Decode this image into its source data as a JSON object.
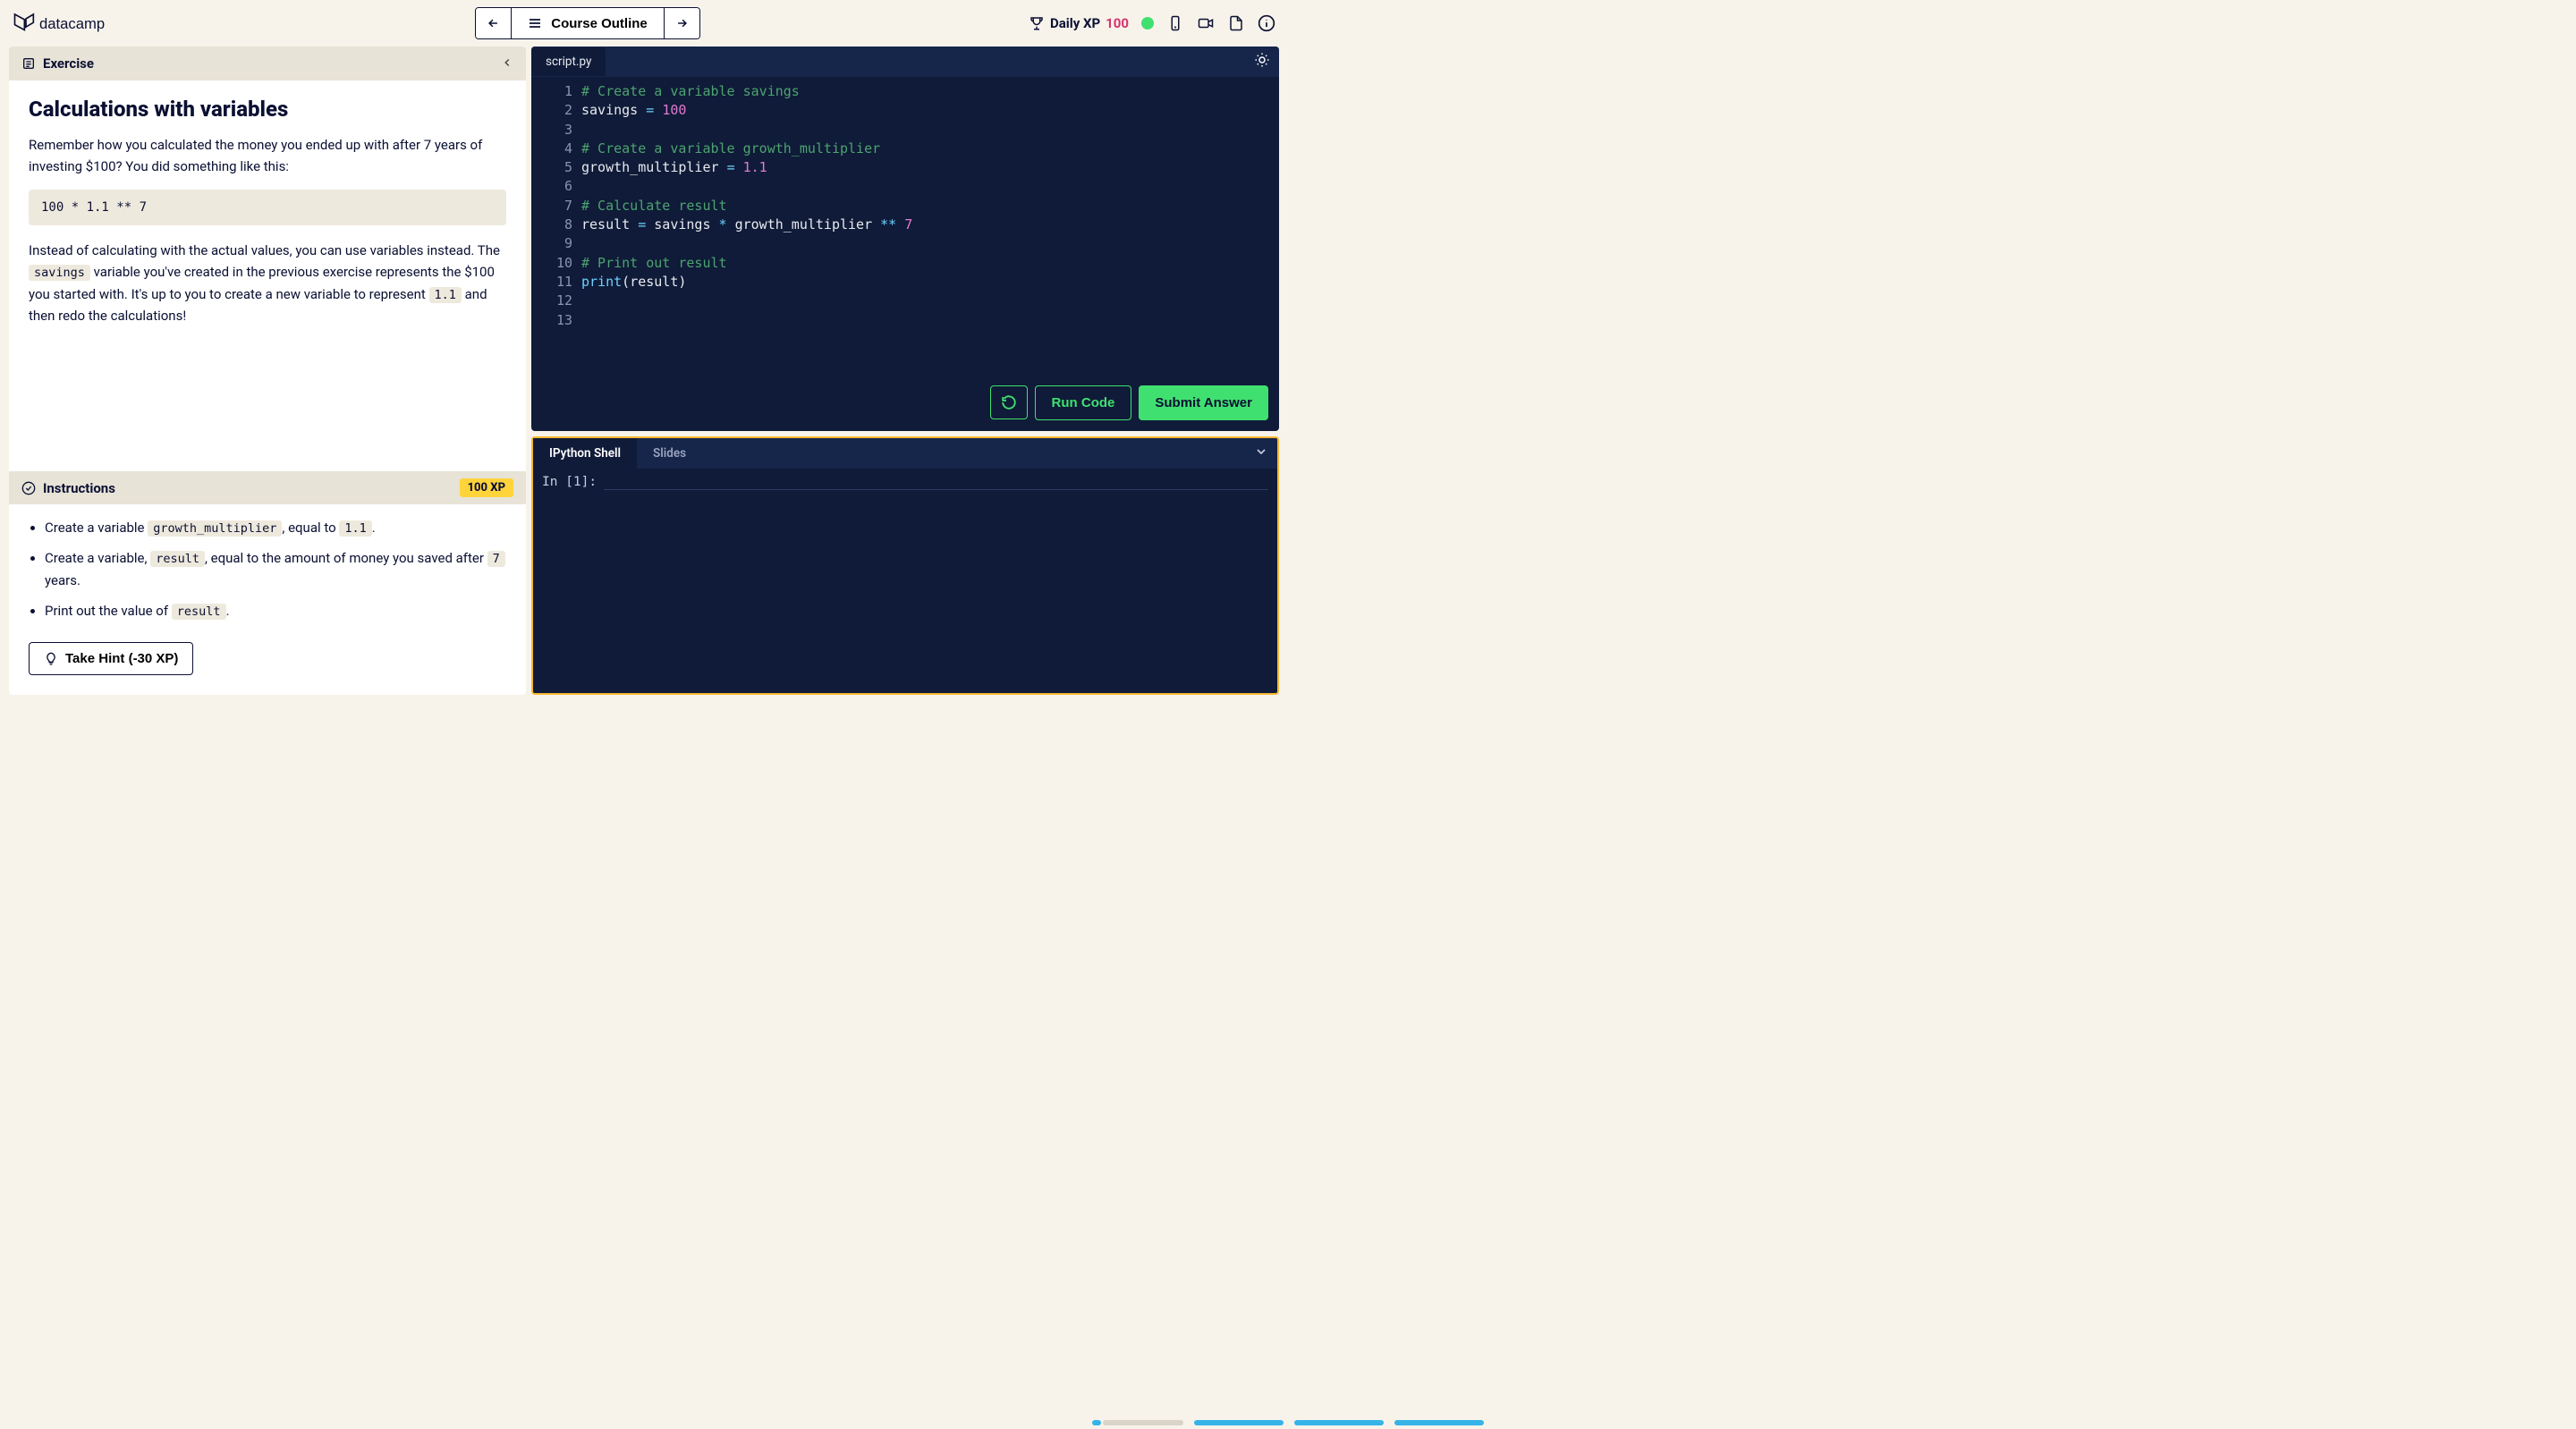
{
  "header": {
    "brand": "datacamp",
    "back_aria": "Previous",
    "forward_aria": "Next",
    "course_outline": "Course Outline",
    "daily_xp_label": "Daily XP",
    "daily_xp_value": "100"
  },
  "exercise": {
    "panel_label": "Exercise",
    "title": "Calculations with variables",
    "intro_before": "Remember how you calculated the money you ended up with after 7 years of investing $100? You did something like this:",
    "example_code": "100 * 1.1 ** 7",
    "para2_a": "Instead of calculating with the actual values, you can use variables instead. The ",
    "para2_code1": "savings",
    "para2_b": " variable you've created in the previous exercise represents the $100 you started with. It's up to you to create a new variable to represent ",
    "para2_code2": "1.1",
    "para2_c": " and then redo the calculations!"
  },
  "instructions": {
    "label": "Instructions",
    "xp": "100 XP",
    "i1_a": "Create a variable ",
    "i1_code1": "growth_multiplier",
    "i1_b": ", equal to ",
    "i1_code2": "1.1",
    "i1_c": ".",
    "i2_a": "Create a variable, ",
    "i2_code1": "result",
    "i2_b": ", equal to the amount of money you saved after ",
    "i2_code2": "7",
    "i2_c": " years.",
    "i3_a": "Print out the value of ",
    "i3_code1": "result",
    "i3_b": ".",
    "hint": "Take Hint (-30 XP)"
  },
  "editor": {
    "tab": "script.py",
    "lines": {
      "l1": "# Create a variable savings",
      "l2a": "savings ",
      "l2op": "=",
      "l2b": " ",
      "l2num": "100",
      "l3": "",
      "l4": "# Create a variable growth_multiplier",
      "l5a": "growth_multiplier ",
      "l5op": "=",
      "l5b": " ",
      "l5num": "1.1",
      "l6": "",
      "l7": "# Calculate result",
      "l8a": "result ",
      "l8op1": "=",
      "l8b": " savings ",
      "l8op2": "*",
      "l8c": " growth_multiplier ",
      "l8op3": "**",
      "l8d": " ",
      "l8num": "7",
      "l9": "",
      "l10": "# Print out result",
      "l11a": "print",
      "l11b": "(result)",
      "l12": "",
      "l13": ""
    },
    "gutter": [
      "1",
      "2",
      "3",
      "4",
      "5",
      "6",
      "7",
      "8",
      "9",
      "10",
      "11",
      "12",
      "13"
    ],
    "run": "Run Code",
    "submit": "Submit Answer"
  },
  "shell": {
    "tab_shell": "IPython Shell",
    "tab_slides": "Slides",
    "prompt": "In  [1]:"
  }
}
